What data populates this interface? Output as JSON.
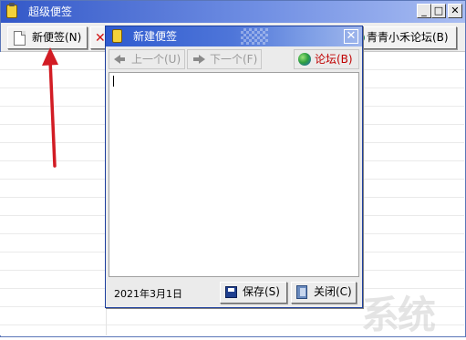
{
  "main_window": {
    "title": "超级便签",
    "controls": {
      "minimize": "_",
      "maximize": "□",
      "close": "✕"
    }
  },
  "toolbar": {
    "new_note_label": "新便签(N)",
    "delete_icon": "✕",
    "forum_label": "青青小禾论坛(B)"
  },
  "note_dialog": {
    "title": "新建便签",
    "close": "✕",
    "nav": {
      "prev_label": "上一个(U)",
      "next_label": "下一个(F)",
      "forum_label": "论坛(B)"
    },
    "content": "",
    "date": "2021年3月1日",
    "save_label": "保存(S)",
    "close_label": "关闭(C)"
  },
  "watermark": {
    "text": "系统"
  },
  "colors": {
    "titlebar_blue": "#3358c8",
    "note_border": "#1d3f9e",
    "arrow_red": "#d21c24",
    "forum_red": "#c00000"
  },
  "icons": {
    "title": "note-icon",
    "new_note": "document-icon",
    "delete": "delete-x-icon",
    "forum": "globe-icon",
    "save": "floppy-icon",
    "close": "exit-door-icon"
  }
}
